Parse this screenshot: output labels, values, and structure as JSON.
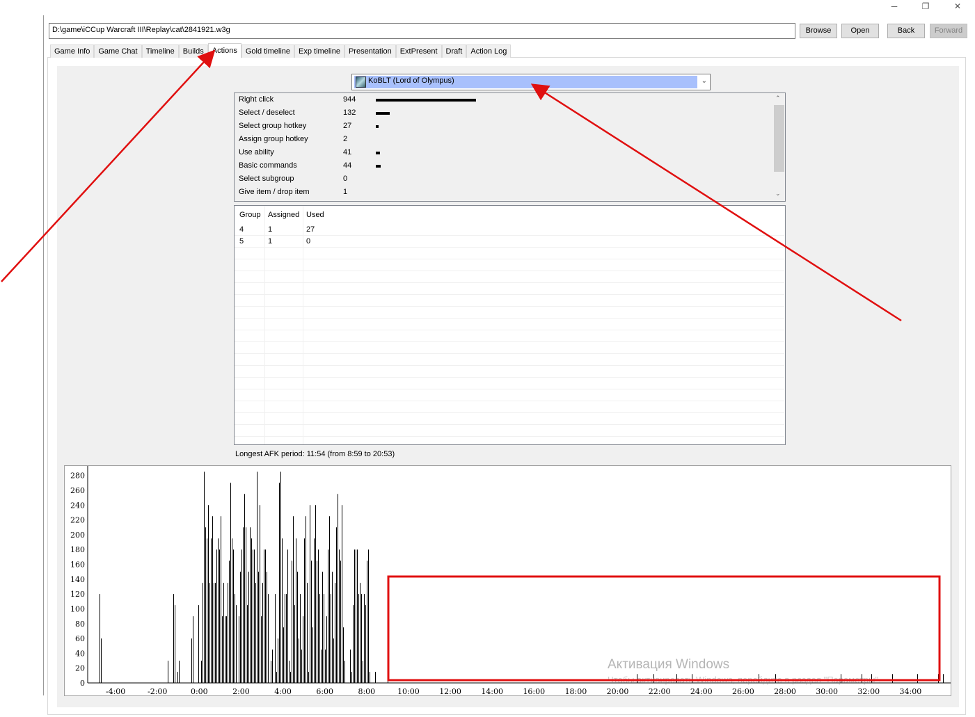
{
  "window": {
    "minimize": "─",
    "restore": "❐",
    "close": "✕"
  },
  "toolbar": {
    "path": "D:\\game\\iCCup Warcraft III\\Replay\\cat\\2841921.w3g",
    "browse": "Browse",
    "open": "Open",
    "back": "Back",
    "forward": "Forward"
  },
  "tabs": [
    {
      "label": "Game Info"
    },
    {
      "label": "Game Chat"
    },
    {
      "label": "Timeline"
    },
    {
      "label": "Builds"
    },
    {
      "label": "Actions",
      "active": true
    },
    {
      "label": "Gold timeline"
    },
    {
      "label": "Exp timeline"
    },
    {
      "label": "Presentation"
    },
    {
      "label": "ExtPresent"
    },
    {
      "label": "Draft"
    },
    {
      "label": "Action Log"
    }
  ],
  "player_select": {
    "value": "KoBLT (Lord of Olympus)",
    "icon": "hero-portrait-icon"
  },
  "actions": [
    {
      "name": "Right click",
      "count": 944
    },
    {
      "name": "Select / deselect",
      "count": 132
    },
    {
      "name": "Select group hotkey",
      "count": 27
    },
    {
      "name": "Assign group hotkey",
      "count": 2
    },
    {
      "name": "Use ability",
      "count": 41
    },
    {
      "name": "Basic commands",
      "count": 44
    },
    {
      "name": "Select subgroup",
      "count": 0
    },
    {
      "name": "Give item / drop item",
      "count": 1
    }
  ],
  "groups": {
    "headers": [
      "Group",
      "Assigned",
      "Used"
    ],
    "rows": [
      [
        "4",
        "1",
        "27"
      ],
      [
        "5",
        "1",
        "0"
      ]
    ]
  },
  "afk": "Longest AFK period: 11:54 (from 8:59 to 20:53)",
  "watermark": {
    "line1": "Активация Windows",
    "line2": "Чтобы активировать Windows, перейдите в раздел \"Параметры\"."
  },
  "annotation_color": "#e01010",
  "chart_data": {
    "type": "bar",
    "title": "",
    "xlabel": "",
    "ylabel": "",
    "x_unit": "seconds (game time, m:ss)",
    "xlim": [
      -320,
      2155
    ],
    "ylim": [
      0,
      290
    ],
    "xticks": [
      "-4:00",
      "-2:00",
      "0:00",
      "2:00",
      "4:00",
      "6:00",
      "8:00",
      "10:00",
      "12:00",
      "14:00",
      "16:00",
      "18:00",
      "20:00",
      "22:00",
      "24:00",
      "26:00",
      "28:00",
      "30:00",
      "32:00",
      "34:00"
    ],
    "yticks": [
      0,
      20,
      40,
      60,
      80,
      100,
      120,
      140,
      160,
      180,
      200,
      220,
      240,
      260,
      280
    ],
    "grid": false,
    "points": [
      [
        -287,
        120
      ],
      [
        -283,
        60
      ],
      [
        -91,
        30
      ],
      [
        -75,
        120
      ],
      [
        -71,
        105
      ],
      [
        -63,
        15
      ],
      [
        -59,
        30
      ],
      [
        -23,
        60
      ],
      [
        -19,
        90
      ],
      [
        -3,
        105
      ],
      [
        5,
        30
      ],
      [
        9,
        135
      ],
      [
        13,
        285
      ],
      [
        17,
        210
      ],
      [
        21,
        195
      ],
      [
        25,
        240
      ],
      [
        29,
        135
      ],
      [
        33,
        195
      ],
      [
        37,
        225
      ],
      [
        41,
        135
      ],
      [
        45,
        135
      ],
      [
        49,
        180
      ],
      [
        53,
        195
      ],
      [
        57,
        180
      ],
      [
        61,
        225
      ],
      [
        65,
        90
      ],
      [
        69,
        135
      ],
      [
        73,
        90
      ],
      [
        77,
        90
      ],
      [
        81,
        135
      ],
      [
        85,
        165
      ],
      [
        89,
        270
      ],
      [
        93,
        195
      ],
      [
        97,
        180
      ],
      [
        101,
        120
      ],
      [
        105,
        105
      ],
      [
        113,
        90
      ],
      [
        117,
        150
      ],
      [
        121,
        180
      ],
      [
        125,
        210
      ],
      [
        129,
        255
      ],
      [
        133,
        210
      ],
      [
        137,
        105
      ],
      [
        141,
        150
      ],
      [
        145,
        210
      ],
      [
        149,
        195
      ],
      [
        153,
        180
      ],
      [
        157,
        180
      ],
      [
        161,
        135
      ],
      [
        165,
        285
      ],
      [
        169,
        150
      ],
      [
        173,
        240
      ],
      [
        177,
        90
      ],
      [
        181,
        135
      ],
      [
        185,
        180
      ],
      [
        189,
        180
      ],
      [
        193,
        150
      ],
      [
        197,
        120
      ],
      [
        205,
        30
      ],
      [
        209,
        45
      ],
      [
        217,
        120
      ],
      [
        221,
        15
      ],
      [
        225,
        60
      ],
      [
        229,
        270
      ],
      [
        233,
        285
      ],
      [
        237,
        195
      ],
      [
        241,
        75
      ],
      [
        245,
        120
      ],
      [
        249,
        120
      ],
      [
        253,
        180
      ],
      [
        257,
        30
      ],
      [
        261,
        15
      ],
      [
        265,
        165
      ],
      [
        269,
        225
      ],
      [
        273,
        105
      ],
      [
        277,
        195
      ],
      [
        281,
        150
      ],
      [
        285,
        60
      ],
      [
        289,
        120
      ],
      [
        293,
        45
      ],
      [
        297,
        90
      ],
      [
        301,
        195
      ],
      [
        305,
        225
      ],
      [
        309,
        135
      ],
      [
        313,
        15
      ],
      [
        317,
        240
      ],
      [
        321,
        165
      ],
      [
        325,
        75
      ],
      [
        329,
        195
      ],
      [
        333,
        240
      ],
      [
        337,
        165
      ],
      [
        341,
        180
      ],
      [
        345,
        120
      ],
      [
        349,
        45
      ],
      [
        353,
        150
      ],
      [
        357,
        120
      ],
      [
        361,
        45
      ],
      [
        365,
        90
      ],
      [
        369,
        180
      ],
      [
        373,
        225
      ],
      [
        377,
        120
      ],
      [
        381,
        150
      ],
      [
        385,
        60
      ],
      [
        389,
        135
      ],
      [
        393,
        210
      ],
      [
        397,
        255
      ],
      [
        401,
        180
      ],
      [
        405,
        165
      ],
      [
        409,
        240
      ],
      [
        413,
        75
      ],
      [
        417,
        30
      ],
      [
        433,
        45
      ],
      [
        437,
        15
      ],
      [
        441,
        105
      ],
      [
        445,
        180
      ],
      [
        449,
        180
      ],
      [
        453,
        180
      ],
      [
        457,
        120
      ],
      [
        461,
        135
      ],
      [
        465,
        120
      ],
      [
        469,
        30
      ],
      [
        473,
        120
      ],
      [
        477,
        105
      ],
      [
        481,
        165
      ],
      [
        485,
        180
      ],
      [
        489,
        15
      ],
      [
        505,
        15
      ],
      [
        541,
        15
      ],
      [
        1254,
        12
      ],
      [
        1302,
        12
      ],
      [
        1369,
        12
      ],
      [
        1413,
        12
      ],
      [
        1605,
        12
      ],
      [
        1652,
        12
      ],
      [
        1840,
        12
      ],
      [
        1900,
        12
      ],
      [
        1928,
        12
      ],
      [
        1987,
        12
      ],
      [
        2059,
        12
      ],
      [
        2119,
        12
      ],
      [
        2133,
        12
      ]
    ]
  }
}
